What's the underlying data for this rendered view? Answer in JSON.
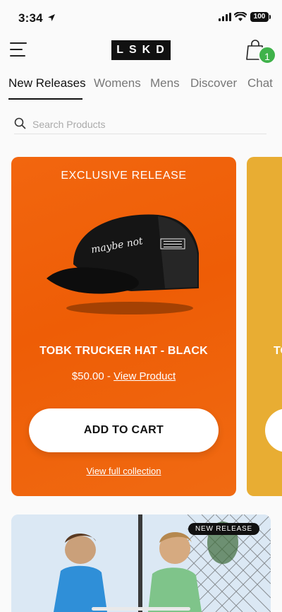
{
  "status": {
    "time": "3:34",
    "battery": "100"
  },
  "header": {
    "logo": "LSKD",
    "cart_count": "1"
  },
  "tabs": [
    "New Releases",
    "Womens",
    "Mens",
    "Discover",
    "Chat"
  ],
  "search": {
    "placeholder": "Search Products"
  },
  "product_card": {
    "eyebrow": "EXCLUSIVE RELEASE",
    "name": "TOBK TRUCKER HAT - BLACK",
    "price": "$50.00",
    "price_sep": " - ",
    "view_link": "View Product",
    "add_to_cart": "ADD TO CART",
    "collection_link": "View full collection",
    "hat_script": "maybe not"
  },
  "next_card": {
    "name_partial": "TO"
  },
  "banner": {
    "badge": "NEW RELEASE"
  },
  "colors": {
    "card_orange": "#f0640c",
    "card_yellow": "#e8ad33",
    "badge_green": "#3fb24a"
  }
}
